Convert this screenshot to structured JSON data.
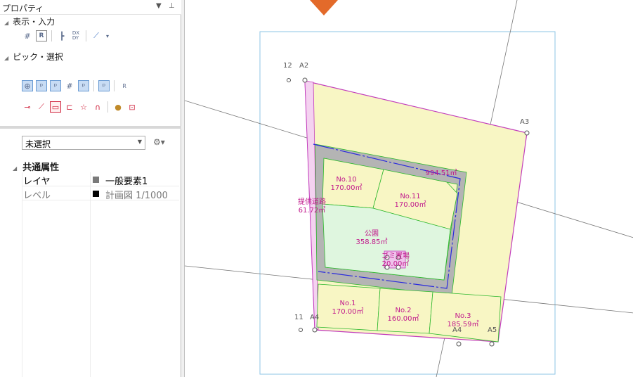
{
  "panel": {
    "title": "プロパティ",
    "sections": {
      "display_input": "表示・入力",
      "pick_select": "ピック・選択"
    },
    "selection": "未選択",
    "common_attributes": "共通属性",
    "properties": [
      {
        "key": "レイヤ",
        "value": "一般要素1",
        "swatch": "#7a7a7a"
      },
      {
        "key": "レベル",
        "value": "計画図 1/1000",
        "swatch": "#000000"
      }
    ]
  },
  "drawing": {
    "points": {
      "a2_num": "12",
      "a2": "A2",
      "a3": "A3",
      "a4_num": "11",
      "a4_label": "A4",
      "a4": "A4",
      "a5": "A5"
    },
    "lots": [
      {
        "name": "No.10",
        "area": "170.00㎡"
      },
      {
        "name": "No.11",
        "area": "170.00㎡"
      },
      {
        "name": "公園",
        "area": "358.85㎡"
      },
      {
        "name": "ゴミ置場",
        "area": "20.00㎡"
      },
      {
        "name": "No.1",
        "area": "170.00㎡"
      },
      {
        "name": "No.2",
        "area": "160.00㎡"
      },
      {
        "name": "No.3",
        "area": "185.59㎡"
      }
    ],
    "road_area": "994.51㎡",
    "provided_road": {
      "name": "提供道路",
      "area": "61.72㎡"
    }
  }
}
